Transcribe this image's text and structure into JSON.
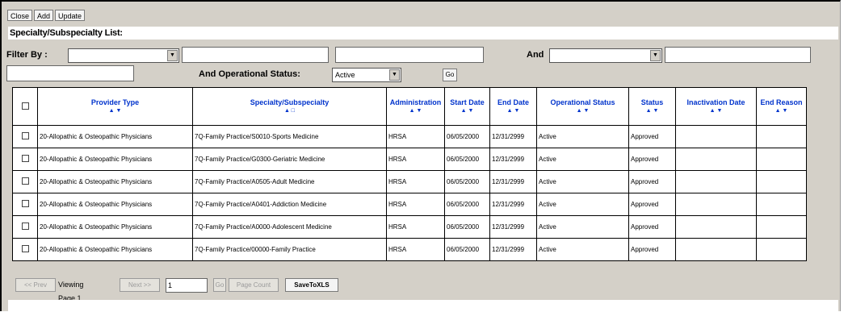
{
  "toolbar": {
    "close": "Close",
    "add": "Add",
    "update": "Update"
  },
  "list_title": "Specialty/Subspecialty List:",
  "filter": {
    "filter_by_label": "Filter By :",
    "and_label": "And",
    "op_status_label": "And Operational Status:",
    "op_status_value": "Active",
    "go": "Go"
  },
  "table": {
    "headers": {
      "provider_type": "Provider Type",
      "specialty": "Specialty/Subspecialty",
      "administration": "Administration",
      "start_date": "Start Date",
      "end_date": "End Date",
      "operational_status": "Operational Status",
      "status": "Status",
      "inactivation_date": "Inactivation Date",
      "end_reason": "End Reason"
    },
    "rows": [
      {
        "provider_type": "20-Allopathic & Osteopathic Physicians",
        "specialty": "7Q-Family Practice/S0010-Sports Medicine",
        "administration": "HRSA",
        "start_date": "06/05/2000",
        "end_date": "12/31/2999",
        "operational_status": "Active",
        "status": "Approved",
        "inactivation_date": "",
        "end_reason": ""
      },
      {
        "provider_type": "20-Allopathic & Osteopathic Physicians",
        "specialty": "7Q-Family Practice/G0300-Geriatric Medicine",
        "administration": "HRSA",
        "start_date": "06/05/2000",
        "end_date": "12/31/2999",
        "operational_status": "Active",
        "status": "Approved",
        "inactivation_date": "",
        "end_reason": ""
      },
      {
        "provider_type": "20-Allopathic & Osteopathic Physicians",
        "specialty": "7Q-Family Practice/A0505-Adult Medicine",
        "administration": "HRSA",
        "start_date": "06/05/2000",
        "end_date": "12/31/2999",
        "operational_status": "Active",
        "status": "Approved",
        "inactivation_date": "",
        "end_reason": ""
      },
      {
        "provider_type": "20-Allopathic & Osteopathic Physicians",
        "specialty": "7Q-Family Practice/A0401-Addiction Medicine",
        "administration": "HRSA",
        "start_date": "06/05/2000",
        "end_date": "12/31/2999",
        "operational_status": "Active",
        "status": "Approved",
        "inactivation_date": "",
        "end_reason": ""
      },
      {
        "provider_type": "20-Allopathic & Osteopathic Physicians",
        "specialty": "7Q-Family Practice/A0000-Adolescent Medicine",
        "administration": "HRSA",
        "start_date": "06/05/2000",
        "end_date": "12/31/2999",
        "operational_status": "Active",
        "status": "Approved",
        "inactivation_date": "",
        "end_reason": ""
      },
      {
        "provider_type": "20-Allopathic & Osteopathic Physicians",
        "specialty": "7Q-Family Practice/00000-Family Practice",
        "administration": "HRSA",
        "start_date": "06/05/2000",
        "end_date": "12/31/2999",
        "operational_status": "Active",
        "status": "Approved",
        "inactivation_date": "",
        "end_reason": ""
      }
    ]
  },
  "pager": {
    "prev": "<< Prev",
    "viewing": "Viewing Page 1",
    "next": "Next >>",
    "page_input": "1",
    "go": "Go",
    "page_count": "Page Count",
    "save": "SaveToXLS"
  },
  "icons": {
    "sort_asc": "triangle-up",
    "sort_desc": "triangle-down",
    "dropdown": "chevron-down"
  },
  "colors": {
    "header_link": "#0033cc",
    "window_bg": "#d4d0c8"
  }
}
